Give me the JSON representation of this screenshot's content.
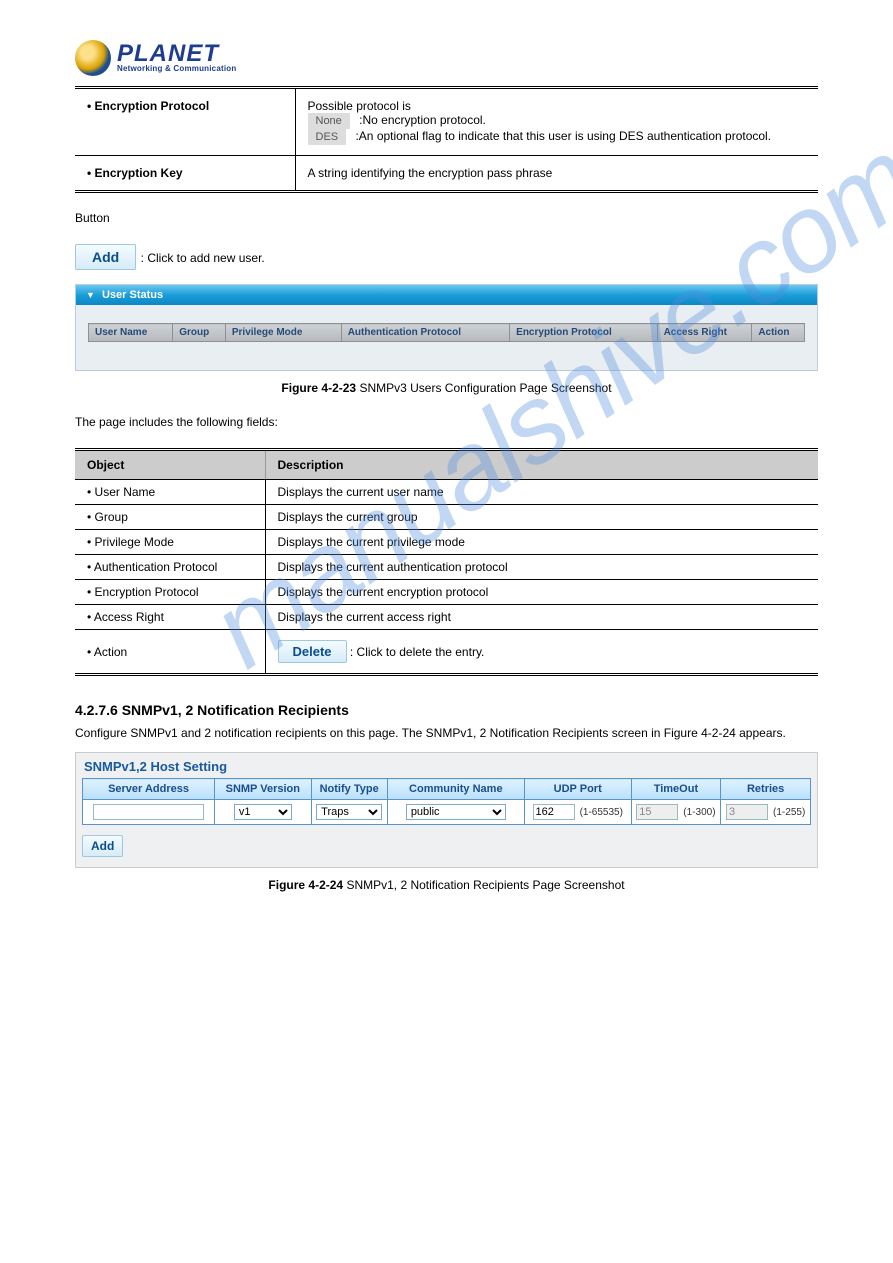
{
  "logo": {
    "main": "PLANET",
    "sub": "Networking & Communication"
  },
  "watermark": "manualshive.com",
  "top_table": {
    "row1": {
      "label": "Encryption Protocol",
      "line1_a": "Possible protocol is  ",
      "chip1": "None",
      "line1_b": ":No encryption protocol.",
      "chip2": "DES",
      "line2_b": ":An optional flag to indicate that this user is using DES authentication protocol."
    },
    "row2": {
      "label": "Encryption Key",
      "desc": "A string identifying the encryption pass phrase"
    }
  },
  "buttons": {
    "add": "Add",
    "delete": "Delete",
    "add_small": "Add"
  },
  "add_sentence_a": ": Click to add new user.",
  "fig1": {
    "panel_title": "User Status",
    "headers": [
      "User Name",
      "Group",
      "Privilege Mode",
      "Authentication Protocol",
      "Encryption Protocol",
      "Access Right",
      "Action"
    ],
    "caption_num": "Figure 4-2-23",
    "caption_txt": " SNMPv3 Users Configuration Page Screenshot"
  },
  "obj_intro": "The page includes the following fields:",
  "obj_table": {
    "h1": "Object",
    "h2": "Description",
    "rows": [
      {
        "l": "User Name",
        "r": "Displays the current user name"
      },
      {
        "l": "Group",
        "r": "Displays the current group"
      },
      {
        "l": "Privilege Mode",
        "r": "Displays the current privilege mode"
      },
      {
        "l": "Authentication Protocol",
        "r": "Displays the current authentication protocol"
      },
      {
        "l": "Encryption Protocol",
        "r": "Displays the current encryption protocol"
      },
      {
        "l": "Access Right",
        "r": "Displays the current access right"
      }
    ],
    "action_l": "Action",
    "action_r": ": Click to delete the entry."
  },
  "section": {
    "head": "4.2.7.6 SNMPv1, 2 Notification Recipients",
    "sub": "Configure SNMPv1 and 2 notification recipients on this page. The SNMPv1, 2 Notification Recipients screen in Figure 4-2-24 appears."
  },
  "host": {
    "title": "SNMPv1,2 Host Setting",
    "headers": [
      "Server Address",
      "SNMP Version",
      "Notify Type",
      "Community Name",
      "UDP Port",
      "TimeOut",
      "Retries"
    ],
    "snmp_version": "v1",
    "notify_type": "Traps",
    "community": "public",
    "udp_val": "162",
    "udp_rng": "(1-65535)",
    "timeout_val": "15",
    "timeout_rng": "(1-300)",
    "retries_val": "3",
    "retries_rng": "(1-255)"
  },
  "fig3_caption_num": "Figure 4-2-24",
  "fig3_caption_txt": " SNMPv1, 2 Notification Recipients Page Screenshot"
}
